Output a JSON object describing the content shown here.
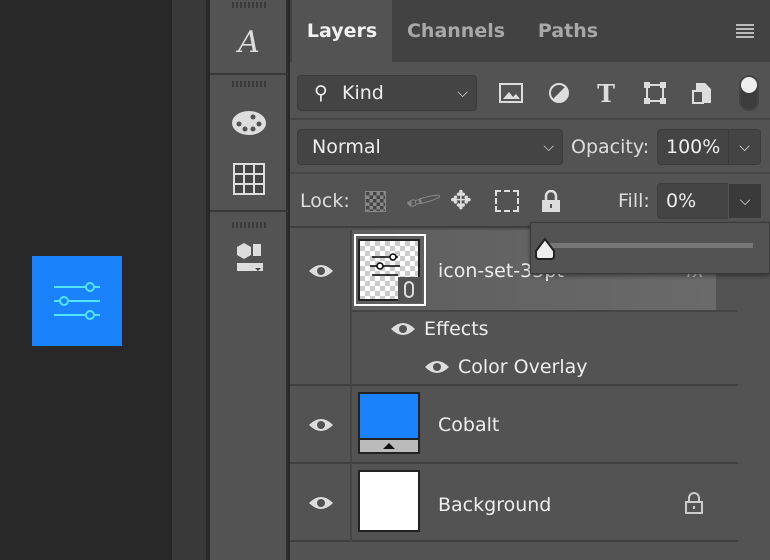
{
  "canvas": {
    "swatch_color": "#1a82fb",
    "icon": "sliders-icon"
  },
  "toolbar": {
    "icons": [
      "character-style-icon",
      "swatches-palette-icon",
      "grid-icon",
      "3d-materials-icon"
    ]
  },
  "tabs": [
    {
      "label": "Layers",
      "active": true
    },
    {
      "label": "Channels"
    },
    {
      "label": "Paths"
    }
  ],
  "filter": {
    "label": "Kind",
    "icons": [
      "image-filter-icon",
      "adjustment-filter-icon",
      "type-filter-icon",
      "shape-filter-icon",
      "smart-object-filter-icon"
    ]
  },
  "blend": {
    "mode": "Normal",
    "opacity_label": "Opacity:",
    "opacity": "100%"
  },
  "lock": {
    "label": "Lock:",
    "fill_label": "Fill:",
    "fill": "0%",
    "fill_slider_value": 0
  },
  "layers": [
    {
      "name": "icon-set-35pt",
      "fx": "fx",
      "effects_label": "Effects",
      "effect": "Color Overlay"
    },
    {
      "name": "Cobalt",
      "color": "#1a82fb"
    },
    {
      "name": "Background",
      "locked": true
    }
  ]
}
